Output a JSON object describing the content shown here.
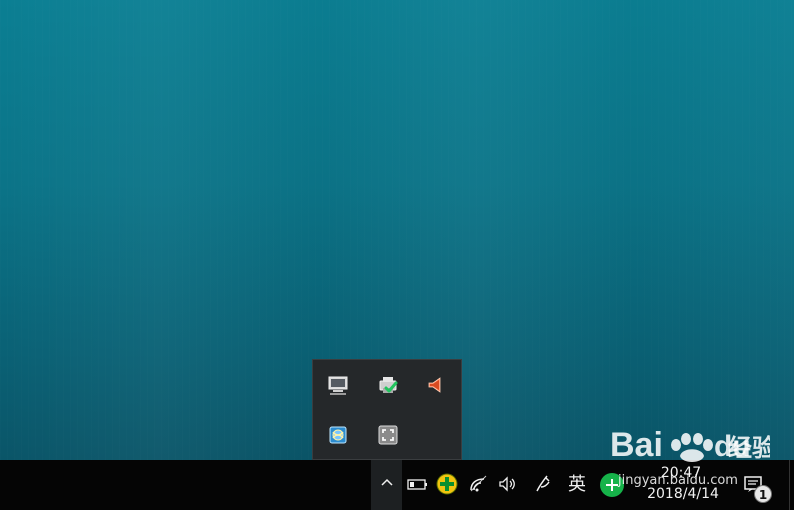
{
  "taskbar": {
    "ime_label": "英",
    "clock_time": "20:47",
    "clock_date": "2018/4/14",
    "notification_count": "1"
  },
  "watermark": {
    "brand": "Baidu 经验",
    "url": "jingyan.baidu.com"
  },
  "icons": {
    "hidden_tray": [
      "monitor-icon",
      "printer-check-icon",
      "speaker-icon",
      "network-globe-icon",
      "screenshot-icon"
    ],
    "taskbar": [
      "chevron-up-icon",
      "battery-icon",
      "security-plus-icon",
      "wifi-icon",
      "volume-icon",
      "pen-icon",
      "green-status-icon",
      "notification-center-icon"
    ]
  },
  "colors": {
    "desktop": "#0b6f83",
    "taskbar": "#050505",
    "popup": "#25282a",
    "green_icon": "#16b34a",
    "security_icon": "#f1c40f"
  }
}
